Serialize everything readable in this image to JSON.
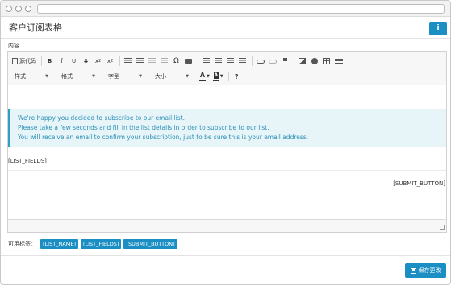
{
  "page": {
    "title": "客户订阅表格"
  },
  "header": {
    "info_icon": "info-icon"
  },
  "form": {
    "content_label": "内容"
  },
  "toolbar": {
    "source_label": "源代码",
    "style_combo": "样式",
    "format_combo": "格式",
    "font_combo": "字型",
    "size_combo": "大小",
    "icons": [
      "bold",
      "italic",
      "underline",
      "strikethrough",
      "subscript",
      "superscript",
      "numbered-list",
      "bulleted-list",
      "outdent",
      "indent",
      "special-char",
      "blockquote",
      "align-left",
      "align-center",
      "align-right",
      "justify",
      "link",
      "unlink",
      "anchor",
      "image",
      "flash",
      "table",
      "horizontal-rule",
      "text-color",
      "bg-color",
      "help"
    ]
  },
  "editor": {
    "alert_lines": [
      "We're happy you decided to subscribe to our email list.",
      "Please take a few seconds and fill in the list details in order to subscribe to our list.",
      "You will receive an email to confirm your subscription, just to be sure this is your email address."
    ],
    "list_fields_placeholder": "[LIST_FIELDS]",
    "submit_placeholder": "[SUBMIT_BUTTON]"
  },
  "tags": {
    "label": "可用标签：",
    "items": [
      "[LIST_NAME]",
      "[LIST_FIELDS]",
      "[SUBMIT_BUTTON]"
    ]
  },
  "actions": {
    "save_label": "保存更改"
  },
  "colors": {
    "accent": "#1b8ec3",
    "alert_bg": "#e7f5f9",
    "alert_text": "#2c8fb5"
  }
}
